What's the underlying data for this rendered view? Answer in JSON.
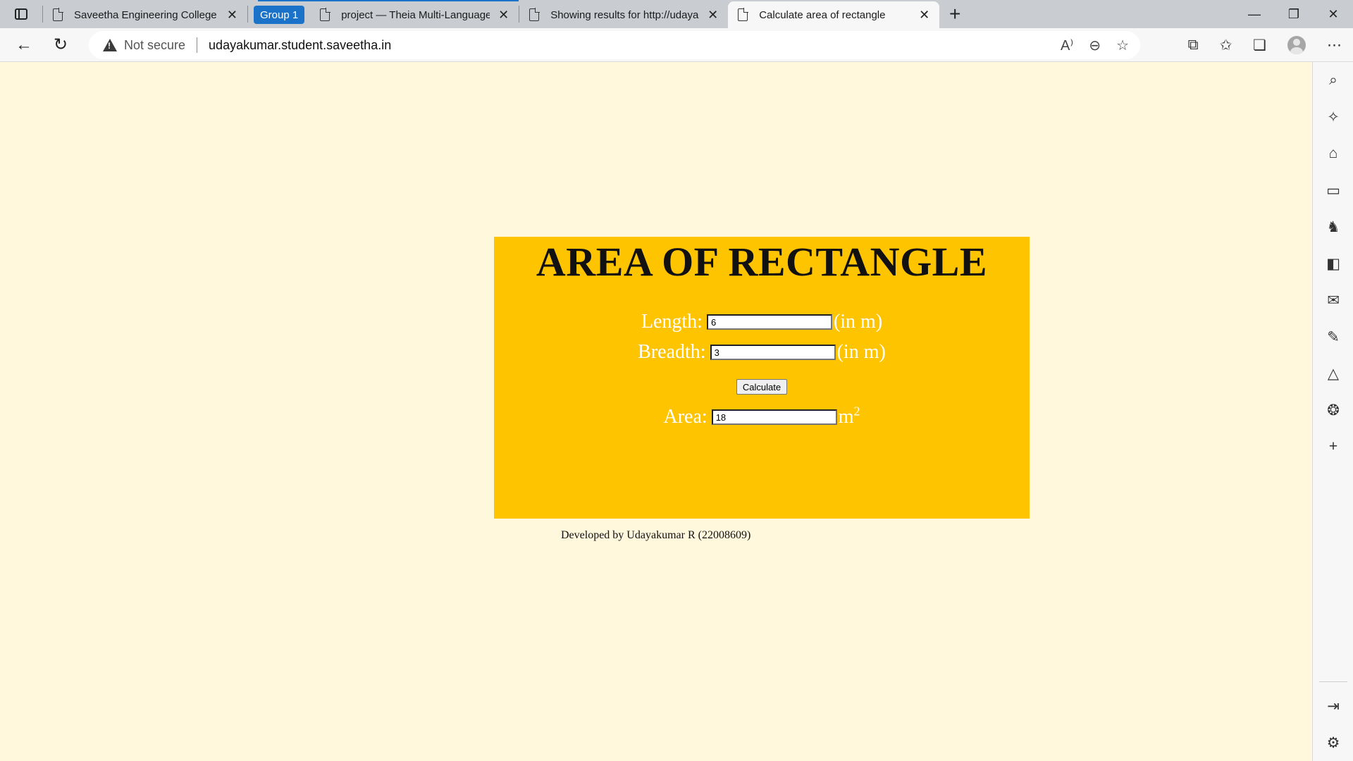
{
  "browser": {
    "tabs": [
      {
        "title": "Saveetha Engineering College"
      },
      {
        "title": "project — Theia Multi-Language"
      },
      {
        "title": "Showing results for http://udayakumar.student.saveetha.in"
      },
      {
        "title": "Calculate area of rectangle"
      }
    ],
    "group_label": "Group 1",
    "address": {
      "security_text": "Not secure",
      "url": "udayakumar.student.saveetha.in"
    },
    "accent_color": "#1a73c8"
  },
  "page": {
    "heading": "AREA OF RECTANGLE",
    "length": {
      "label": "Length:",
      "value": "6",
      "unit": "(in m)"
    },
    "breadth": {
      "label": "Breadth:",
      "value": "3",
      "unit": "(in m)"
    },
    "calculate_label": "Calculate",
    "area": {
      "label": "Area:",
      "value": "18",
      "unit": "m",
      "unit_exponent": "2"
    },
    "footer": "Developed by Udayakumar R (22008609)",
    "background_color": "#fff8dc",
    "panel_color": "#ffc400"
  }
}
